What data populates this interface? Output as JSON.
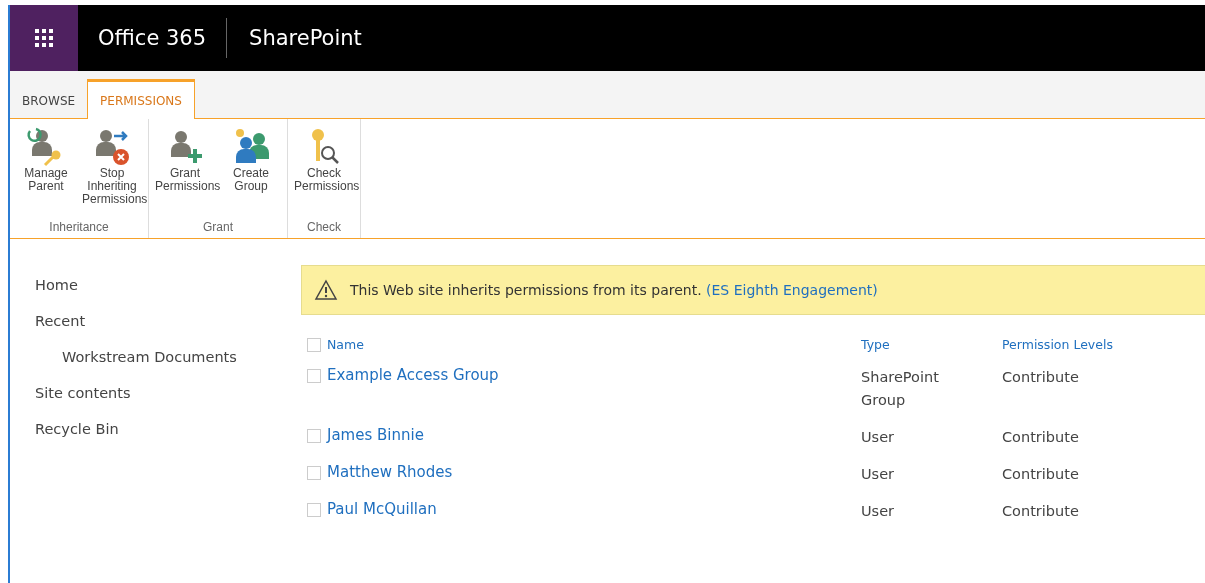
{
  "suite_bar": {
    "brand": "Office 365",
    "app": "SharePoint"
  },
  "ribbon": {
    "tabs": [
      {
        "label": "BROWSE",
        "selected": false
      },
      {
        "label": "PERMISSIONS",
        "selected": true
      }
    ],
    "groups": [
      {
        "label": "Inheritance",
        "buttons": [
          {
            "label": "Manage Parent",
            "kind": "manage"
          },
          {
            "label": "Stop Inheriting Permissions",
            "kind": "stop"
          }
        ]
      },
      {
        "label": "Grant",
        "buttons": [
          {
            "label": "Grant Permissions",
            "kind": "grant"
          },
          {
            "label": "Create Group",
            "kind": "group"
          }
        ]
      },
      {
        "label": "Check",
        "buttons": [
          {
            "label": "Check Permissions",
            "kind": "check"
          }
        ]
      }
    ]
  },
  "nav": [
    {
      "label": "Home"
    },
    {
      "label": "Recent",
      "children": [
        {
          "label": "Workstream Documents"
        }
      ]
    },
    {
      "label": "Site contents"
    },
    {
      "label": "Recycle Bin"
    }
  ],
  "notice": {
    "text": "This Web site inherits permissions from its parent.",
    "link": "(ES Eighth Engagement)"
  },
  "table": {
    "select_all": {
      "checked": false
    },
    "columns": [
      "Name",
      "Type",
      "Permission Levels"
    ],
    "rows": [
      {
        "name": "Example Access Group",
        "type": "SharePoint Group",
        "level": "Contribute",
        "checked": false
      },
      {
        "name": "James Binnie",
        "type": "User",
        "level": "Contribute",
        "checked": false
      },
      {
        "name": "Matthew Rhodes",
        "type": "User",
        "level": "Contribute",
        "checked": false
      },
      {
        "name": "Paul McQuillan",
        "type": "User",
        "level": "Contribute",
        "checked": false
      }
    ]
  }
}
